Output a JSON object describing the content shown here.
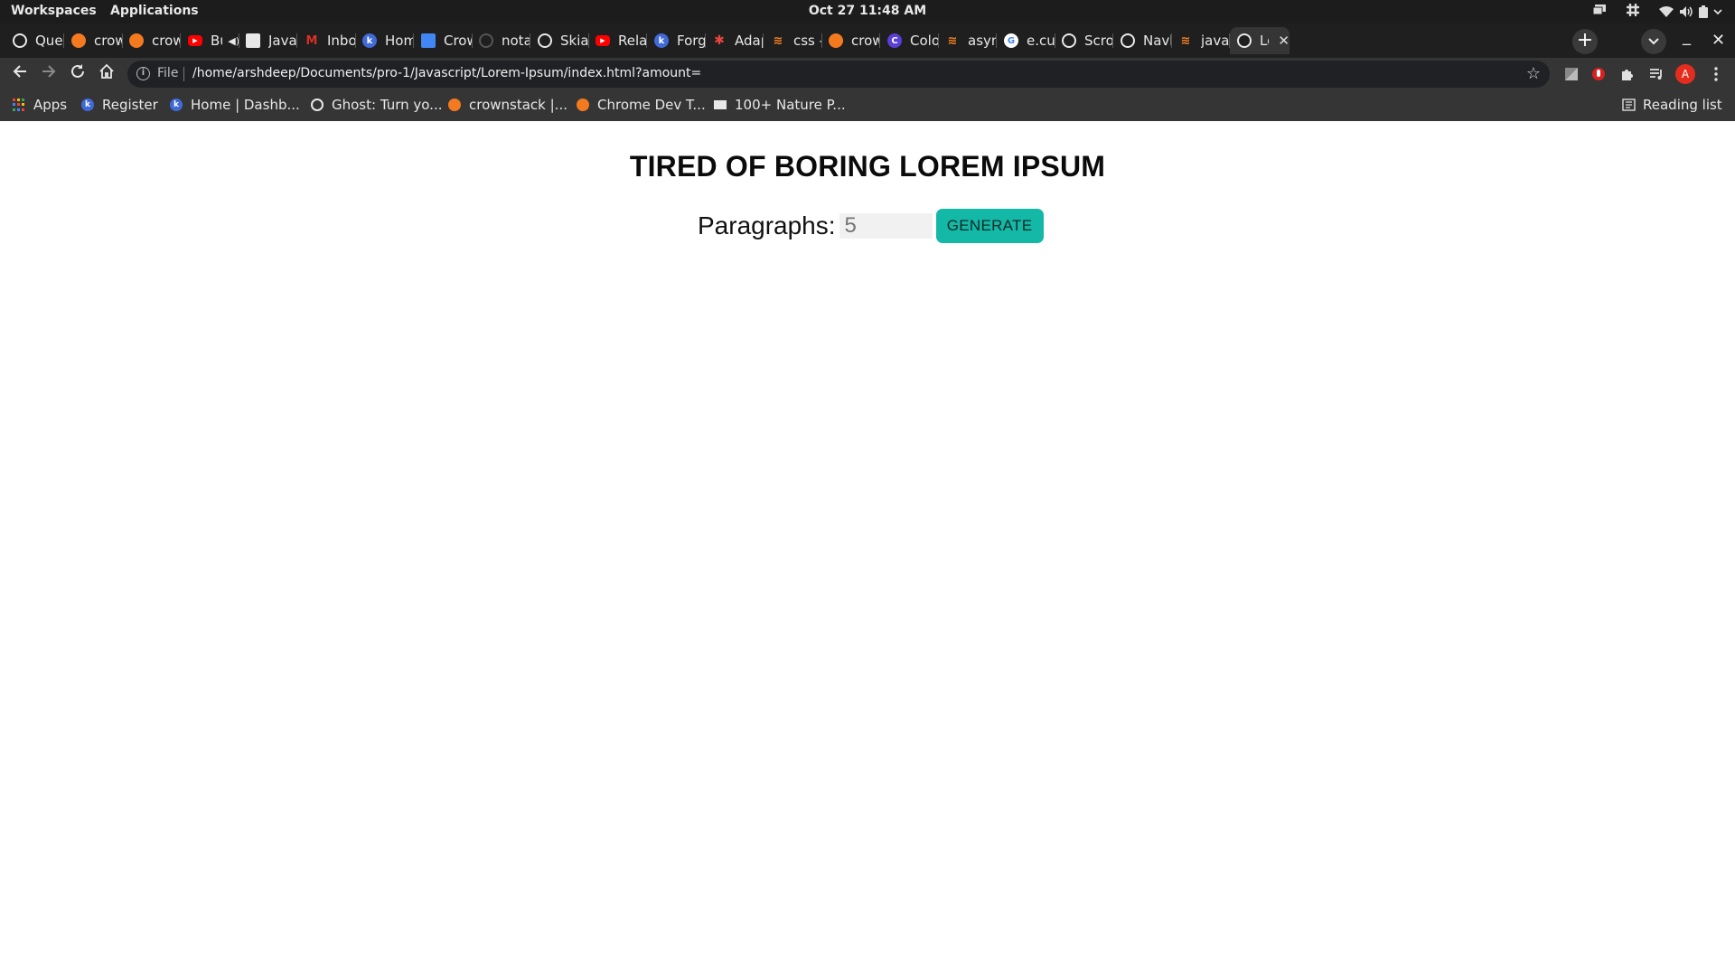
{
  "topbar": {
    "workspaces": "Workspaces",
    "applications": "Applications",
    "clock": "Oct 27  11:48 AM"
  },
  "tabs": [
    {
      "title": "Ques",
      "icon": "chrome-globe-icon",
      "color": "#e8e8e8"
    },
    {
      "title": "crowr",
      "icon": "crownstack-icon",
      "color": "#f47a20"
    },
    {
      "title": "crowr",
      "icon": "crownstack-icon",
      "color": "#f47a20"
    },
    {
      "title": "Bu",
      "icon": "youtube-icon",
      "color": "#ff0000"
    },
    {
      "title": "JavaS",
      "icon": "bookmark-icon",
      "color": "#e8e8e8"
    },
    {
      "title": "Inbox",
      "icon": "gmail-icon",
      "color": "#d93025"
    },
    {
      "title": "Home",
      "icon": "k-icon",
      "color": "#3f6ad8"
    },
    {
      "title": "Crow",
      "icon": "calendar-icon",
      "color": "#4285f4"
    },
    {
      "title": "notas",
      "icon": "loading-icon",
      "color": "#555555"
    },
    {
      "title": "Skia",
      "icon": "chrome-globe-icon",
      "color": "#e8e8e8"
    },
    {
      "title": "Relax",
      "icon": "youtube-icon",
      "color": "#ff0000"
    },
    {
      "title": "Forgo",
      "icon": "k-icon",
      "color": "#3f6ad8"
    },
    {
      "title": "Adap",
      "icon": "asterisk-icon",
      "color": "#e8453c"
    },
    {
      "title": "css -",
      "icon": "stackoverflow-icon",
      "color": "#f48024"
    },
    {
      "title": "crown",
      "icon": "crownstack-icon",
      "color": "#f47a20"
    },
    {
      "title": "Color",
      "icon": "canva-icon",
      "color": "#5a3fd8"
    },
    {
      "title": "async",
      "icon": "stackoverflow-icon",
      "color": "#f48024"
    },
    {
      "title": "e.cur",
      "icon": "google-icon",
      "color": "#4285f4"
    },
    {
      "title": "Scrol",
      "icon": "chrome-globe-icon",
      "color": "#e8e8e8"
    },
    {
      "title": "Navb",
      "icon": "chrome-globe-icon",
      "color": "#e8e8e8"
    },
    {
      "title": "javas",
      "icon": "stackoverflow-icon",
      "color": "#f48024"
    },
    {
      "title": "Lo",
      "icon": "chrome-globe-icon",
      "color": "#e8e8e8",
      "active": true
    }
  ],
  "toolbar": {
    "file_label": "File",
    "url": "/home/arshdeep/Documents/pro-1/Javascript/Lorem-Ipsum/index.html?amount=",
    "profile_initial": "A"
  },
  "bookmarks": [
    {
      "label": "Apps",
      "icon": "apps-grid-icon"
    },
    {
      "label": "Register",
      "icon": "k-icon",
      "color": "#3f6ad8"
    },
    {
      "label": "Home | Dashb...",
      "icon": "k-icon",
      "color": "#3f6ad8"
    },
    {
      "label": "Ghost: Turn yo...",
      "icon": "ghost-icon",
      "color": "#e8e8e8"
    },
    {
      "label": "crownstack |...",
      "icon": "crownstack-icon",
      "color": "#f47a20"
    },
    {
      "label": "Chrome Dev T...",
      "icon": "crownstack-icon",
      "color": "#f47a20"
    },
    {
      "label": "100+ Nature P...",
      "icon": "unsplash-icon",
      "color": "#e8e8e8"
    }
  ],
  "reading_list": "Reading list",
  "page": {
    "title": "TIRED OF BORING LOREM IPSUM",
    "form_label": "Paragraphs:",
    "amount_value": "5",
    "generate_label": "GENERATE"
  },
  "colors": {
    "accent": "#14b8a6",
    "chrome_dark": "#1f1f1f",
    "toolbar": "#353535"
  }
}
